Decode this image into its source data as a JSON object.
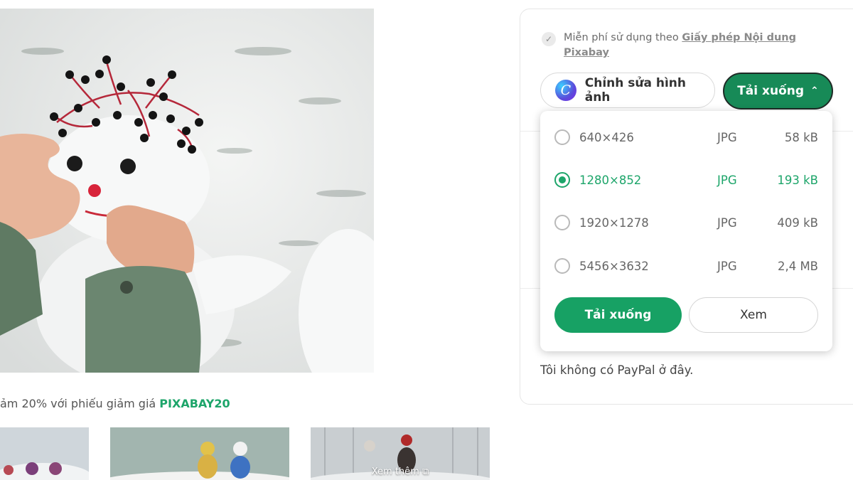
{
  "promo": {
    "prefix": "ảm 20% với phiếu giảm giá ",
    "code": "PIXABAY20"
  },
  "thumbnails": {
    "more_label": "Xem thêm"
  },
  "license": {
    "text": "Miễn phí sử dụng theo ",
    "link": "Giấy phép Nội dung Pixabay"
  },
  "actions": {
    "edit_label": "Chỉnh sửa hình ảnh",
    "canva_letter": "C",
    "download_toggle_label": "Tải xuống"
  },
  "download_options": [
    {
      "resolution": "640×426",
      "format": "JPG",
      "size": "58 kB",
      "selected": false
    },
    {
      "resolution": "1280×852",
      "format": "JPG",
      "size": "193 kB",
      "selected": true
    },
    {
      "resolution": "1920×1278",
      "format": "JPG",
      "size": "409 kB",
      "selected": false
    },
    {
      "resolution": "5456×3632",
      "format": "JPG",
      "size": "2,4 MB",
      "selected": false
    }
  ],
  "dropdown_actions": {
    "download_label": "Tải xuống",
    "view_label": "Xem"
  },
  "paypal_note": "Tôi không có PayPal ở đây.",
  "colors": {
    "accent_green": "#1da56a",
    "toggle_green": "#178a57"
  },
  "icons": {
    "check": "check-icon",
    "canva": "canva-icon",
    "chevron": "chevron-up-icon",
    "external": "external-link-icon"
  }
}
